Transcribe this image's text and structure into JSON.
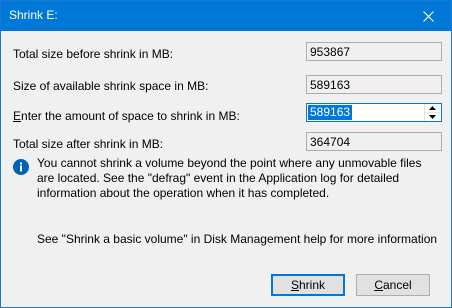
{
  "window": {
    "title": "Shrink E:"
  },
  "rows": {
    "total_before": {
      "label": "Total size before shrink in MB:",
      "value": "953867"
    },
    "available": {
      "label": "Size of available shrink space in MB:",
      "value": "589163"
    },
    "amount": {
      "label_pre": "",
      "label_accel": "E",
      "label_post": "nter the amount of space to shrink in MB:",
      "value": "589163"
    },
    "total_after": {
      "label": "Total size after shrink in MB:",
      "value": "364704"
    }
  },
  "info": {
    "text": "You cannot shrink a volume beyond the point where any unmovable files are located. See the \"defrag\" event in the Application log for detailed information about the operation when it has completed."
  },
  "help": {
    "text": "See \"Shrink a basic volume\" in Disk Management help for more information"
  },
  "buttons": {
    "shrink": {
      "accel": "S",
      "rest": "hrink"
    },
    "cancel": {
      "accel": "C",
      "rest": "ancel"
    }
  },
  "colors": {
    "titlebar": "#0078d7",
    "selection": "#0078d7",
    "info_icon": "#0063b1"
  },
  "icons": {
    "close": "close-icon",
    "info": "info-icon",
    "spin_up": "chevron-up-icon",
    "spin_down": "chevron-down-icon"
  }
}
